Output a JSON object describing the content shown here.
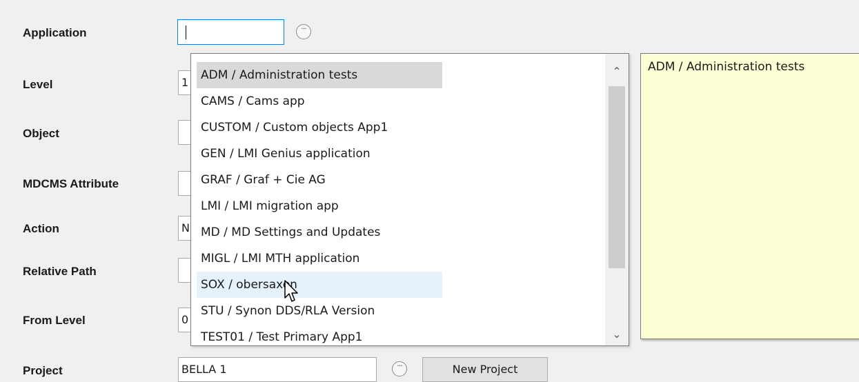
{
  "form": {
    "labels": {
      "application": "Application",
      "level": "Level",
      "object": "Object",
      "mdcms_attribute": "MDCMS Attribute",
      "action": "Action",
      "relative_path": "Relative Path",
      "from_level": "From Level",
      "project": "Project"
    },
    "values": {
      "application": "",
      "level": "1",
      "object": "",
      "mdcms_attribute": "",
      "action": "N",
      "relative_path": "",
      "from_level": "0",
      "project": "BELLA 1"
    },
    "new_project_button": "New Project"
  },
  "dropdown": {
    "options": [
      "ADM / Administration tests",
      "CAMS / Cams app",
      "CUSTOM / Custom objects App1",
      "GEN / LMI Genius application",
      "GRAF / Graf + Cie AG",
      "LMI / LMI migration app",
      "MD / MD Settings and Updates",
      "MIGL / LMI MTH application",
      "SOX / obersaxen",
      "STU / Synon DDS/RLA Version",
      "TEST01 / Test Primary App1"
    ],
    "selected_index": 0,
    "hovered_index": 8
  },
  "description_panel": {
    "text": "ADM / Administration tests"
  },
  "icons": {
    "ellipsis": "ellipsis-icon",
    "scroll_up": "chevron-up-icon",
    "scroll_down": "chevron-down-icon",
    "cursor": "mouse-pointer-icon"
  },
  "colors": {
    "focus_border": "#1979ca",
    "selected_item": "#d9d9d9",
    "hovered_item": "#e5f1fb",
    "description_bg": "#ffffd5"
  }
}
